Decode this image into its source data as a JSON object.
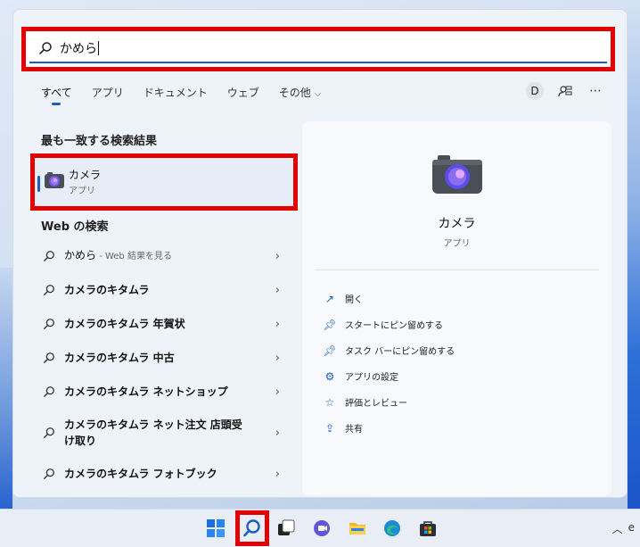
{
  "search": {
    "value": "かめら"
  },
  "tabs": [
    {
      "label": "すべて"
    },
    {
      "label": "アプリ"
    },
    {
      "label": "ドキュメント"
    },
    {
      "label": "ウェブ"
    },
    {
      "label": "その他"
    }
  ],
  "header": {
    "avatar_letter": "D"
  },
  "best_match": {
    "section_title": "最も一致する検索結果",
    "name": "カメラ",
    "type": "アプリ"
  },
  "web": {
    "section_title": "Web の検索",
    "items": [
      {
        "text": "かめら",
        "suffix": " - Web 結果を見る"
      },
      {
        "text": "カメラのキタムラ",
        "suffix": ""
      },
      {
        "text": "カメラのキタムラ 年賀状",
        "suffix": ""
      },
      {
        "text": "カメラのキタムラ 中古",
        "suffix": ""
      },
      {
        "text": "カメラのキタムラ ネットショップ",
        "suffix": ""
      },
      {
        "text": "カメラのキタムラ ネット注文 店頭受け取り",
        "suffix": ""
      },
      {
        "text": "カメラのキタムラ フォトブック",
        "suffix": ""
      }
    ]
  },
  "detail": {
    "app_name": "カメラ",
    "app_type": "アプリ",
    "actions": [
      {
        "label": "開く",
        "icon": "open-icon"
      },
      {
        "label": "スタートにピン留めする",
        "icon": "pin-icon"
      },
      {
        "label": "タスク バーにピン留めする",
        "icon": "pin-icon"
      },
      {
        "label": "アプリの設定",
        "icon": "gear-icon"
      },
      {
        "label": "評価とレビュー",
        "icon": "review-icon"
      },
      {
        "label": "共有",
        "icon": "share-icon"
      }
    ]
  },
  "colors": {
    "accent": "#1a5fbf",
    "highlight": "#e30000"
  }
}
